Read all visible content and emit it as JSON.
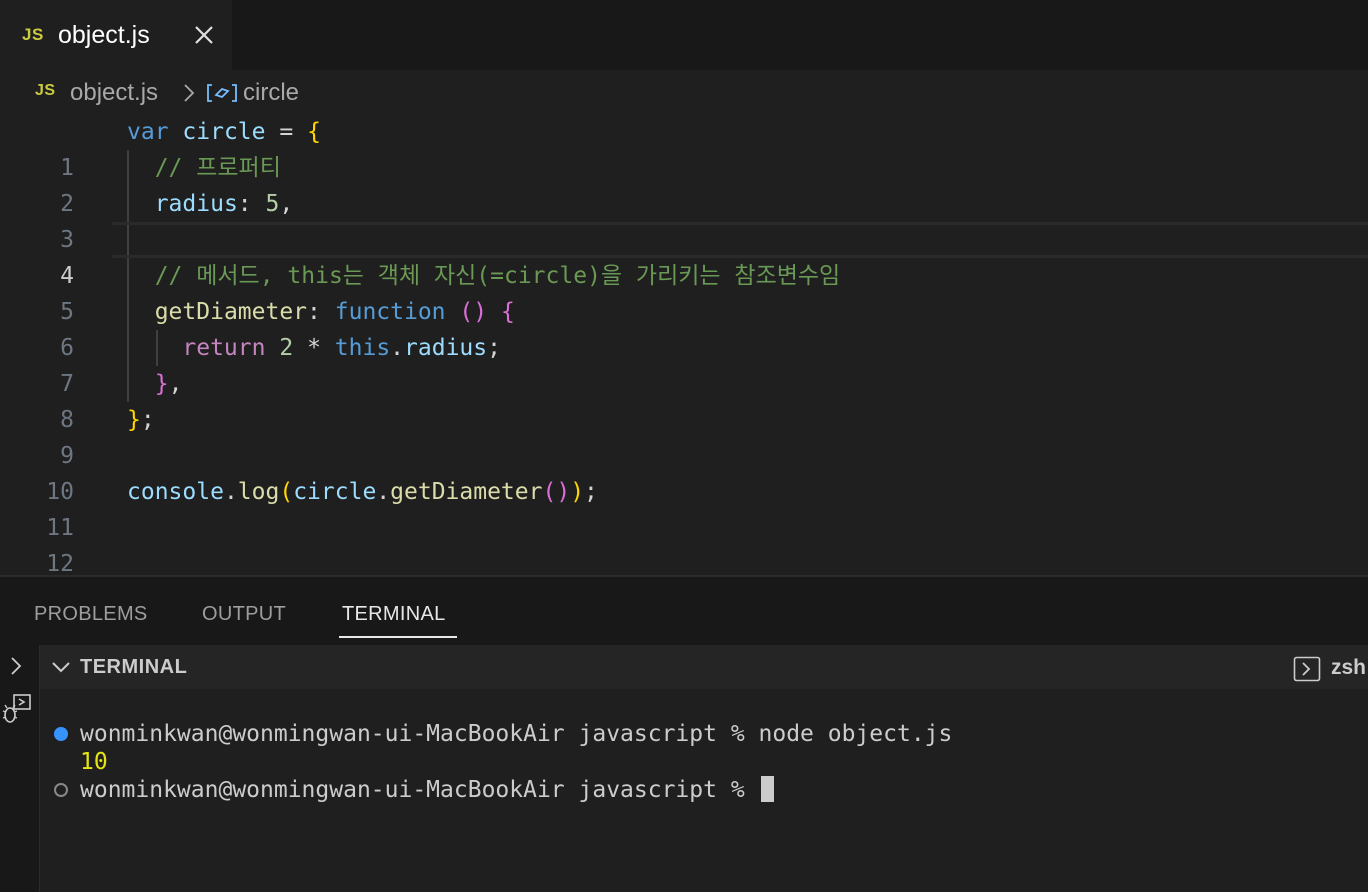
{
  "tab": {
    "badge": "JS",
    "filename": "object.js",
    "close_icon": "close-icon"
  },
  "breadcrumb": {
    "badge": "JS",
    "file": "object.js",
    "separator_icon": "chevron-right-icon",
    "symbol_icon": "variable-icon",
    "symbol": "circle"
  },
  "editor": {
    "line_numbers": [
      "1",
      "2",
      "3",
      "4",
      "5",
      "6",
      "7",
      "8",
      "9",
      "10",
      "11",
      "12"
    ],
    "current_line": "4",
    "lines": [
      "var circle = {",
      "  // 프로퍼티",
      "  radius: 5,",
      "",
      "  // 메서드, this는 객체 자신(=circle)을 가리키는 참조변수임",
      "  getDiameter: function () {",
      "    return 2 * this.radius;",
      "  },",
      "};",
      "",
      "console.log(circle.getDiameter());",
      ""
    ]
  },
  "panel": {
    "tabs": [
      "PROBLEMS",
      "OUTPUT",
      "TERMINAL"
    ],
    "active_tab": "TERMINAL",
    "terminal_title": "TERMINAL",
    "shell": "zsh",
    "shell_icon": "terminal-icon"
  },
  "terminal": {
    "prompt": "wonminkwan@wonmingwan-ui-MacBookAir javascript % ",
    "command": "node object.js",
    "output": "10"
  },
  "colors": {
    "keyword": "#569cd6",
    "variable": "#9cdcfe",
    "function": "#dcdcaa",
    "comment": "#6a9955",
    "number": "#b5cea8",
    "control": "#c586c0",
    "terminal_output": "#e5e510",
    "success_dot": "#3794ff"
  }
}
